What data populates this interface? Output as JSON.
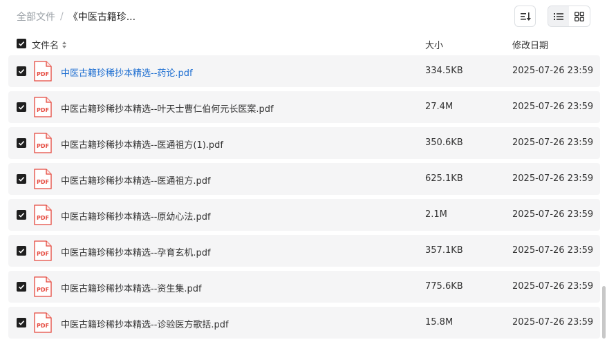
{
  "breadcrumb": {
    "root": "全部文件",
    "separator": "/",
    "current": "《中医古籍珍..."
  },
  "header": {
    "name_label": "文件名",
    "size_label": "大小",
    "date_label": "修改日期"
  },
  "files": [
    {
      "name": "中医古籍珍稀抄本精选--药论.pdf",
      "size": "334.5KB",
      "date": "2025-07-26 23:59",
      "icon_label": "PDF"
    },
    {
      "name": "中医古籍珍稀抄本精选--叶天士曹仁伯何元长医案.pdf",
      "size": "27.4M",
      "date": "2025-07-26 23:59",
      "icon_label": "PDF"
    },
    {
      "name": "中医古籍珍稀抄本精选--医通祖方(1).pdf",
      "size": "350.6KB",
      "date": "2025-07-26 23:59",
      "icon_label": "PDF"
    },
    {
      "name": "中医古籍珍稀抄本精选--医通祖方.pdf",
      "size": "625.1KB",
      "date": "2025-07-26 23:59",
      "icon_label": "PDF"
    },
    {
      "name": "中医古籍珍稀抄本精选--原幼心法.pdf",
      "size": "2.1M",
      "date": "2025-07-26 23:59",
      "icon_label": "PDF"
    },
    {
      "name": "中医古籍珍稀抄本精选--孕育玄机.pdf",
      "size": "357.1KB",
      "date": "2025-07-26 23:59",
      "icon_label": "PDF"
    },
    {
      "name": "中医古籍珍稀抄本精选--资生集.pdf",
      "size": "775.6KB",
      "date": "2025-07-26 23:59",
      "icon_label": "PDF"
    },
    {
      "name": "中医古籍珍稀抄本精选--诊验医方歌括.pdf",
      "size": "15.8M",
      "date": "2025-07-26 23:59",
      "icon_label": "PDF"
    }
  ],
  "colors": {
    "link_blue": "#1f6fd1",
    "pdf_red": "#e5483d",
    "row_bg": "#f5f5f6",
    "checkbox": "#1f1f1f"
  }
}
